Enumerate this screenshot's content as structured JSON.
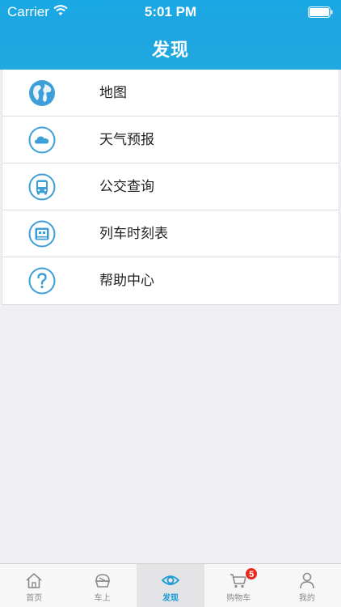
{
  "status_bar": {
    "carrier": "Carrier",
    "time": "5:01 PM"
  },
  "nav": {
    "title": "发现"
  },
  "list": [
    {
      "label": "地图",
      "icon": "globe-icon"
    },
    {
      "label": "天气预报",
      "icon": "cloud-icon"
    },
    {
      "label": "公交查询",
      "icon": "bus-icon"
    },
    {
      "label": "列车时刻表",
      "icon": "train-icon"
    },
    {
      "label": "帮助中心",
      "icon": "help-icon"
    }
  ],
  "tabbar": {
    "tabs": [
      {
        "label": "首页",
        "icon": "home-icon"
      },
      {
        "label": "车上",
        "icon": "car-seat-icon"
      },
      {
        "label": "发现",
        "icon": "eye-icon",
        "active": true
      },
      {
        "label": "购物车",
        "icon": "cart-icon",
        "badge": "5"
      },
      {
        "label": "我的",
        "icon": "user-icon"
      }
    ]
  },
  "colors": {
    "header": "#1ea6e0",
    "icon_blue": "#3d9fd8",
    "active_tab": "#1a9ad6",
    "badge": "#e8271d"
  }
}
